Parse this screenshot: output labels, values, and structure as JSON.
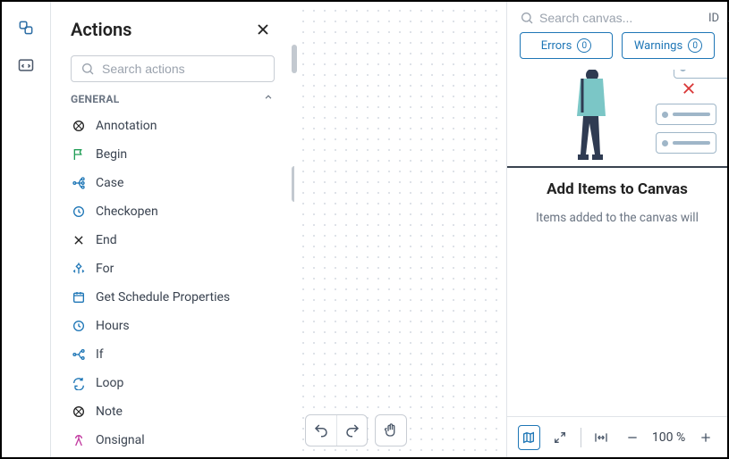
{
  "actions_panel": {
    "title": "Actions",
    "search_placeholder": "Search actions",
    "group_label": "GENERAL",
    "items": [
      {
        "label": "Annotation",
        "icon": "annotation-icon"
      },
      {
        "label": "Begin",
        "icon": "flag-icon"
      },
      {
        "label": "Case",
        "icon": "branch-icon"
      },
      {
        "label": "Checkopen",
        "icon": "clock-icon"
      },
      {
        "label": "End",
        "icon": "x-icon"
      },
      {
        "label": "For",
        "icon": "diamond-arrows-icon"
      },
      {
        "label": "Get Schedule Properties",
        "icon": "calendar-icon"
      },
      {
        "label": "Hours",
        "icon": "clock-icon"
      },
      {
        "label": "If",
        "icon": "branch2-icon"
      },
      {
        "label": "Loop",
        "icon": "loop-icon"
      },
      {
        "label": "Note",
        "icon": "annotation-icon"
      },
      {
        "label": "Onsignal",
        "icon": "signal-icon"
      }
    ]
  },
  "right_panel": {
    "search_placeholder": "Search canvas...",
    "id_label": "ID",
    "tabs": {
      "errors": {
        "label": "Errors",
        "count": "0"
      },
      "warnings": {
        "label": "Warnings",
        "count": "0"
      }
    },
    "empty_title": "Add Items to Canvas",
    "empty_sub": "Items added to the canvas will"
  },
  "footer": {
    "zoom_label": "100 %"
  },
  "colors": {
    "accent": "#1e76b6",
    "danger": "#d93636",
    "flag_green": "#1f9d55",
    "signal_pink": "#c23aa0"
  }
}
